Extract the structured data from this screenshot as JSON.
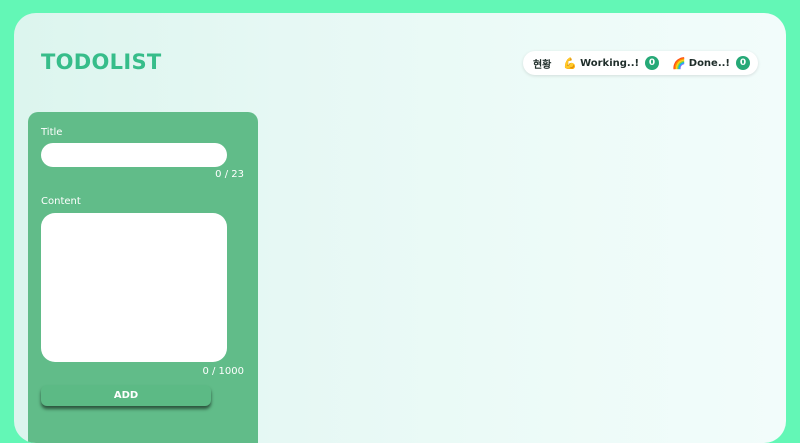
{
  "app": {
    "title": "TODOLIST"
  },
  "status": {
    "heading": "현황",
    "working": {
      "emoji": "💪",
      "label": "Working..!",
      "count": "0",
      "icon": "flexed-biceps-icon"
    },
    "done": {
      "emoji": "🌈",
      "label": "Done..!",
      "count": "0",
      "icon": "rainbow-icon"
    }
  },
  "form": {
    "title_label": "Title",
    "title_value": "",
    "title_counter": "0 / 23",
    "content_label": "Content",
    "content_value": "",
    "content_counter": "0 / 1000",
    "add_label": "ADD"
  },
  "colors": {
    "page_background": "#63f7b6",
    "accent": "#37bd8a",
    "panel": "#61bc89",
    "badge": "#26a977"
  }
}
